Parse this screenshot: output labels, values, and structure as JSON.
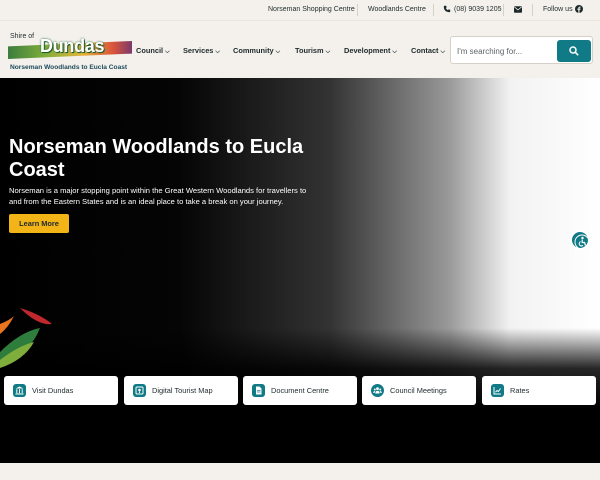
{
  "topbar": {
    "shopping": "Norseman Shopping Centre",
    "woodlands": "Woodlands Centre",
    "phone": "(08) 9039 1205",
    "follow": "Follow us"
  },
  "logo": {
    "shire": "Shire of",
    "name": "Dundas",
    "tagline": "Norseman Woodlands to Eucla Coast"
  },
  "nav": {
    "items": [
      {
        "label": "Council"
      },
      {
        "label": "Services"
      },
      {
        "label": "Community"
      },
      {
        "label": "Tourism"
      },
      {
        "label": "Development"
      },
      {
        "label": "Contact"
      }
    ]
  },
  "search": {
    "placeholder": "I'm searching for..."
  },
  "hero": {
    "title": "Norseman Woodlands to Eucla Coast",
    "body": "Norseman is a major stopping point within the Great Western Woodlands for travellers to and from the Eastern States and is an ideal place to take a break on your journey.",
    "cta": "Learn More"
  },
  "quick_links": [
    {
      "label": "Visit Dundas",
      "icon": "bank-icon"
    },
    {
      "label": "Digital Tourist Map",
      "icon": "map-icon"
    },
    {
      "label": "Document Centre",
      "icon": "document-icon"
    },
    {
      "label": "Council Meetings",
      "icon": "people-icon"
    },
    {
      "label": "Rates",
      "icon": "chart-icon"
    }
  ],
  "colors": {
    "accent_teal": "#117a87",
    "button_yellow": "#f3b418",
    "background": "#f4f1ec"
  }
}
